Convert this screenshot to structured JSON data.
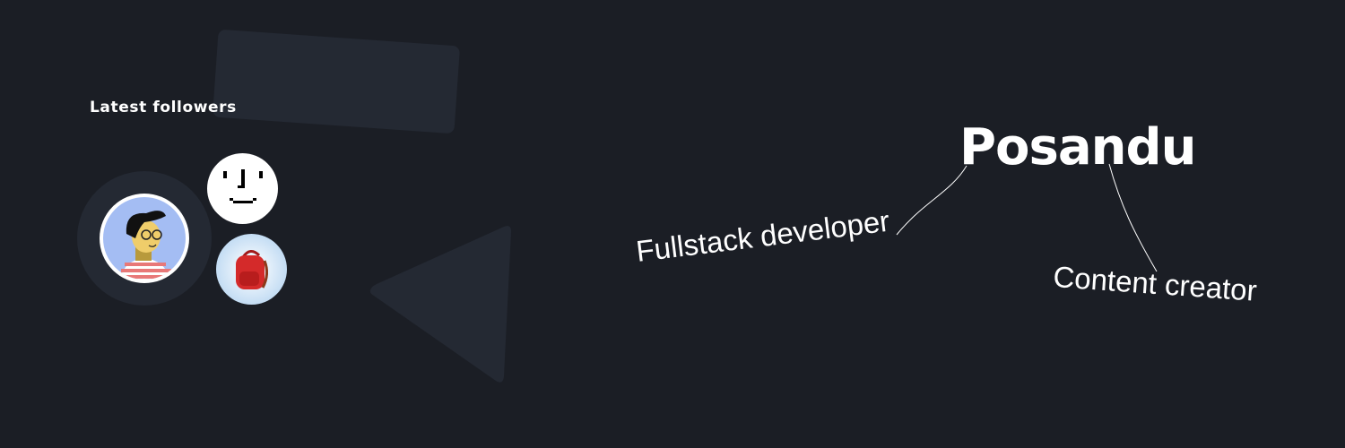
{
  "followers": {
    "title": "Latest followers",
    "avatars": [
      {
        "icon": "avatar-cartoon-person"
      },
      {
        "icon": "avatar-pixel-face"
      },
      {
        "icon": "avatar-backpack"
      }
    ]
  },
  "profile": {
    "name": "Posandu",
    "roles": [
      "Fullstack developer",
      "Content creator"
    ]
  },
  "colors": {
    "background": "#1b1e25",
    "shape": "#242933",
    "text": "#ffffff"
  }
}
